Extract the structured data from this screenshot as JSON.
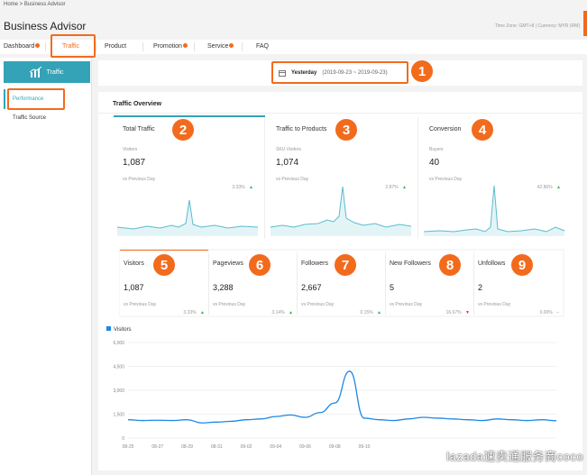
{
  "breadcrumb": "Home  >  Business Advisor",
  "title": "Business Advisor",
  "timezone": "Time Zone: GMT+8 | Currency: MYR (RM)",
  "nav": [
    {
      "label": "Dashboard",
      "dot": true
    },
    {
      "label": "Traffic",
      "dot": false,
      "active": true
    },
    {
      "label": "Product",
      "dot": false
    },
    {
      "label": "Promotion",
      "dot": true
    },
    {
      "label": "Service",
      "dot": true
    },
    {
      "label": "FAQ",
      "dot": false
    }
  ],
  "sidebar": {
    "header": "Traffic",
    "items": [
      "Performance",
      "Traffic Source"
    ]
  },
  "date": {
    "label": "Yesterday",
    "range": "(2019-09-23 ~ 2019-09-23)"
  },
  "badges": [
    "1",
    "2",
    "3",
    "4",
    "5",
    "6",
    "7",
    "8",
    "9"
  ],
  "overview": {
    "title": "Traffic Overview",
    "cards": [
      {
        "title": "Total Traffic",
        "sub": "Visitors",
        "value": "1,087",
        "cmp": "vs Previous Day",
        "pct": "3.33%",
        "dir": "up"
      },
      {
        "title": "Traffic to Products",
        "sub": "SKU Visitors",
        "value": "1,074",
        "cmp": "vs Previous Day",
        "pct": "2.87%",
        "dir": "up"
      },
      {
        "title": "Conversion",
        "sub": "Buyers",
        "value": "40",
        "cmp": "vs Previous Day",
        "pct": "42.86%",
        "dir": "up"
      }
    ]
  },
  "metrics": [
    {
      "title": "Visitors",
      "value": "1,087",
      "cmp": "vs Previous Day",
      "pct": "3.33%",
      "dir": "up"
    },
    {
      "title": "Pageviews",
      "value": "3,288",
      "cmp": "vs Previous Day",
      "pct": "3.14%",
      "dir": "up"
    },
    {
      "title": "Followers",
      "value": "2,667",
      "cmp": "vs Previous Day",
      "pct": "0.15%",
      "dir": "up"
    },
    {
      "title": "New Followers",
      "value": "5",
      "cmp": "vs Previous Day",
      "pct": "16.67%",
      "dir": "down"
    },
    {
      "title": "Unfollows",
      "value": "2",
      "cmp": "vs Previous Day",
      "pct": "0.00%",
      "dir": "flat"
    }
  ],
  "colors": {
    "accent": "#f26b1d",
    "teal": "#34a3b8",
    "line": "#1e88e5",
    "spark": "#5bbccd",
    "up": "#2fb34a",
    "down": "#e0342b"
  },
  "icons": {
    "calendar": "calendar-icon",
    "chart": "chart-up-icon"
  },
  "watermark": "lazada速卖通服务商coco",
  "chart_data": {
    "type": "line",
    "legend": "Visitors",
    "x": [
      "08-25",
      "08-26",
      "08-27",
      "08-28",
      "08-29",
      "08-30",
      "08-31",
      "09-01",
      "09-02",
      "09-03",
      "09-04",
      "09-05",
      "09-06",
      "09-07",
      "09-08",
      "09-09",
      "09-10",
      "09-11",
      "09-12",
      "09-13",
      "09-14",
      "09-15",
      "09-16",
      "09-17",
      "09-18",
      "09-19",
      "09-20",
      "09-21",
      "09-22",
      "09-23"
    ],
    "xticks": [
      "08-25",
      "08-27",
      "08-29",
      "08-31",
      "09-02",
      "09-04",
      "09-06",
      "09-08",
      "09-10"
    ],
    "yticks": [
      "0",
      "1,500",
      "3,000",
      "4,500",
      "6,000"
    ],
    "ylim": [
      0,
      6000
    ],
    "series": [
      {
        "name": "Visitors",
        "values": [
          1150,
          1100,
          1120,
          1100,
          1150,
          950,
          1000,
          1050,
          1150,
          1200,
          1350,
          1450,
          1300,
          1600,
          2200,
          4200,
          1250,
          1150,
          1100,
          1200,
          1300,
          1250,
          1200,
          1150,
          1100,
          1200,
          1150,
          1100,
          1150,
          1087
        ]
      }
    ]
  }
}
